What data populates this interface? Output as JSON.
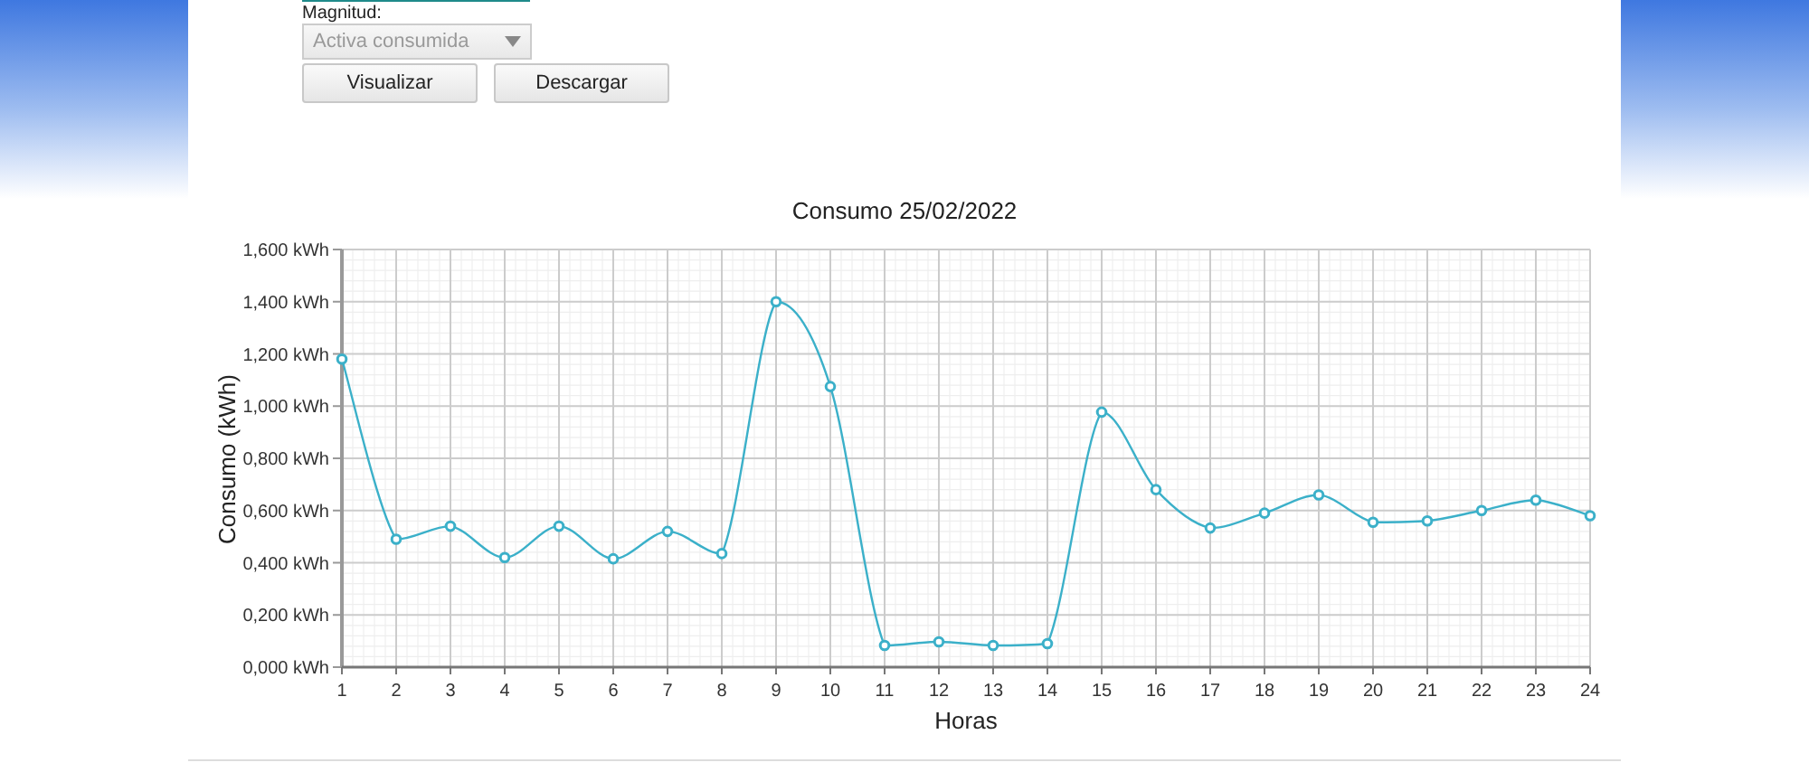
{
  "form": {
    "magnitude_label": "Magnitud:",
    "magnitude_select": {
      "value": "Activa consumida",
      "disabled": true
    },
    "buttons": [
      "Visualizar",
      "Descargar"
    ]
  },
  "chart": {
    "chart_data": {
      "type": "line",
      "title": "Consumo 25/02/2022",
      "xlabel": "Horas",
      "ylabel": "Consumo (kWh)",
      "x": [
        1,
        2,
        3,
        4,
        5,
        6,
        7,
        8,
        9,
        10,
        11,
        12,
        13,
        14,
        15,
        16,
        17,
        18,
        19,
        20,
        21,
        22,
        23,
        24
      ],
      "grid": true,
      "series": [
        {
          "color": "#3bb0c9",
          "marker": "circle",
          "values": [
            1.18,
            0.49,
            0.54,
            0.42,
            0.54,
            0.415,
            0.52,
            0.435,
            1.4,
            1.075,
            0.083,
            0.097,
            0.083,
            0.09,
            0.977,
            0.68,
            0.533,
            0.59,
            0.66,
            0.555,
            0.56,
            0.6,
            0.64,
            0.58
          ]
        }
      ],
      "xlim": [
        1,
        24
      ],
      "ylim": [
        0,
        1.6
      ],
      "xticks": [
        1,
        2,
        3,
        4,
        5,
        6,
        7,
        8,
        9,
        10,
        11,
        12,
        13,
        14,
        15,
        16,
        17,
        18,
        19,
        20,
        21,
        22,
        23,
        24
      ],
      "yticks": [
        {
          "value": 0,
          "label": "0,000 kWh"
        },
        {
          "value": 0.2,
          "label": "0,200 kWh"
        },
        {
          "value": 0.4,
          "label": "0,400 kWh"
        },
        {
          "value": 0.6,
          "label": "0,600 kWh"
        },
        {
          "value": 0.8,
          "label": "0,800 kWh"
        },
        {
          "value": 1,
          "label": "1,000 kWh"
        },
        {
          "value": 1.2,
          "label": "1,200 kWh"
        },
        {
          "value": 1.4,
          "label": "1,400 kWh"
        },
        {
          "value": 1.6,
          "label": "1,600 kWh"
        }
      ]
    }
  }
}
